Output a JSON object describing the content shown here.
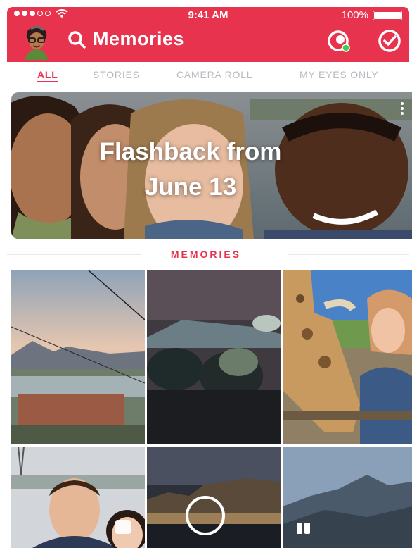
{
  "status_bar": {
    "time": "9:41 AM",
    "battery": "100%"
  },
  "header": {
    "title": "Memories"
  },
  "tabs": [
    {
      "label": "ALL",
      "active": true
    },
    {
      "label": "STORIES",
      "active": false
    },
    {
      "label": "CAMERA ROLL",
      "active": false
    },
    {
      "label": "MY EYES ONLY",
      "active": false
    }
  ],
  "flashback": {
    "line1": "Flashback from",
    "line2": "June 13"
  },
  "section": {
    "label": "MEMORIES"
  },
  "colors": {
    "accent": "#e8334f",
    "online": "#3ccf4e"
  },
  "icons": [
    "search-icon",
    "lens-icon",
    "check-circle-icon",
    "more-icon",
    "multi-snap-icon",
    "play-ring-icon"
  ]
}
